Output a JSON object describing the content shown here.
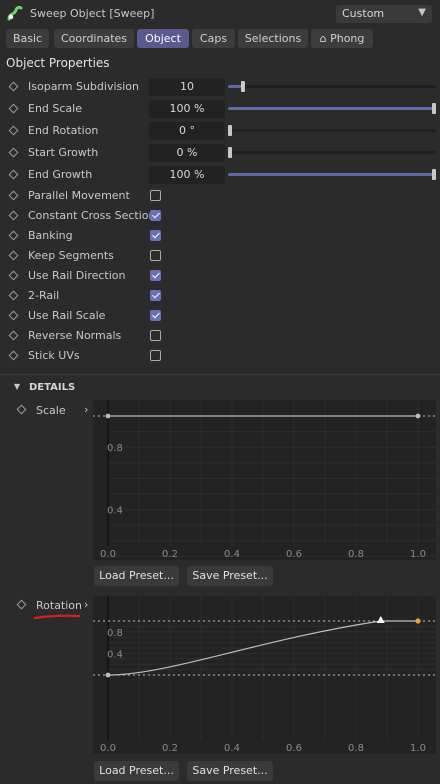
{
  "window": {
    "title": "Sweep Object [Sweep]",
    "mode": "Custom"
  },
  "tabs": [
    {
      "label": "Basic",
      "active": false
    },
    {
      "label": "Coordinates",
      "active": false
    },
    {
      "label": "Object",
      "active": true
    },
    {
      "label": "Caps",
      "active": false
    },
    {
      "label": "Selections",
      "active": false
    },
    {
      "label": "Phong",
      "icon": "home-icon",
      "active": false
    }
  ],
  "section_title": "Object Properties",
  "numeric_props": [
    {
      "label": "Isoparm Subdivision",
      "value": "10",
      "slider_fraction": 0.07
    },
    {
      "label": "End Scale",
      "value": "100 %",
      "slider_fraction": 1.0
    },
    {
      "label": "End Rotation",
      "value": "0 °",
      "slider_fraction": 0.0
    },
    {
      "label": "Start Growth",
      "value": "0 %",
      "slider_fraction": 0.0
    },
    {
      "label": "End Growth",
      "value": "100 %",
      "slider_fraction": 1.0
    }
  ],
  "bool_props": [
    {
      "label": "Parallel Movement",
      "checked": false
    },
    {
      "label": "Constant Cross Section",
      "checked": true
    },
    {
      "label": "Banking",
      "checked": true
    },
    {
      "label": "Keep Segments",
      "checked": false
    },
    {
      "label": "Use Rail Direction",
      "checked": true
    },
    {
      "label": "2-Rail",
      "checked": true
    },
    {
      "label": "Use Rail Scale",
      "checked": true
    },
    {
      "label": "Reverse Normals",
      "checked": false
    },
    {
      "label": "Stick UVs",
      "checked": false
    }
  ],
  "details": {
    "label": "DETAILS"
  },
  "curves": [
    {
      "label": "Scale",
      "x_ticks": [
        "0.0",
        "0.2",
        "0.4",
        "0.6",
        "0.8",
        "1.0"
      ],
      "y_ticks": [
        "0.8",
        "0.4"
      ],
      "points": [
        [
          0.0,
          1.0
        ],
        [
          1.0,
          1.0
        ]
      ],
      "load_label": "Load Preset...",
      "save_label": "Save Preset..."
    },
    {
      "label": "Rotation",
      "x_ticks": [
        "0.0",
        "0.2",
        "0.4",
        "0.6",
        "0.8",
        "1.0"
      ],
      "y_ticks": [
        "0.8",
        "0.4"
      ],
      "points": [
        [
          0.0,
          0.0
        ],
        [
          0.88,
          1.0
        ],
        [
          1.0,
          1.0
        ]
      ],
      "load_label": "Load Preset...",
      "save_label": "Save Preset..."
    }
  ],
  "colors": {
    "accent": "#5a5a8e",
    "slider_fill": "#6468a8",
    "checkbox": "#6a6fb8",
    "curve_end_point": "#f0a030",
    "annotation_mark": "#d42020"
  }
}
